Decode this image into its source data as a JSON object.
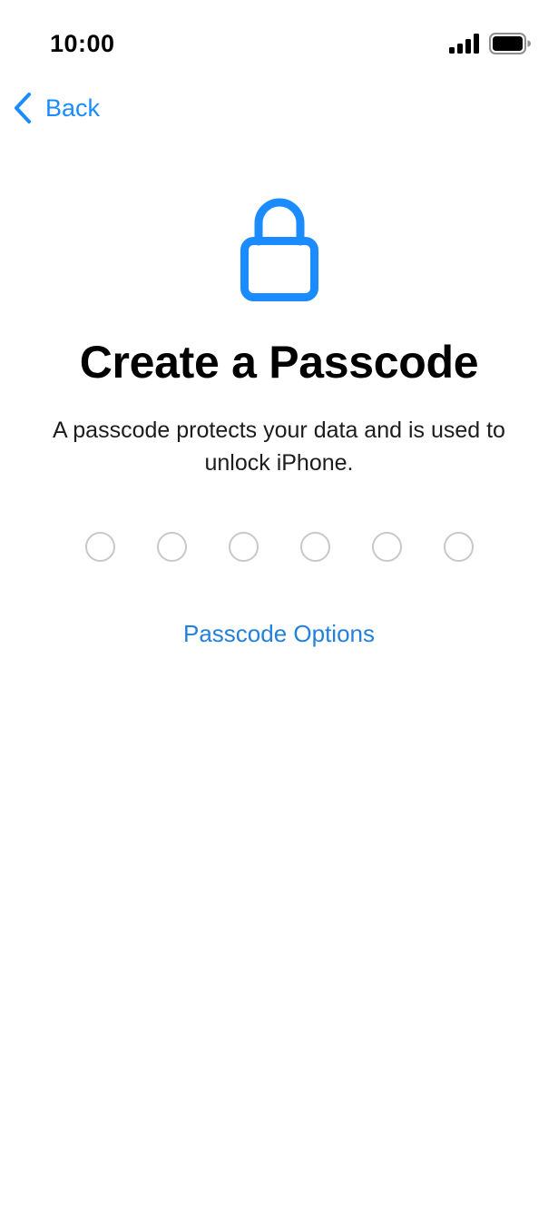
{
  "status_bar": {
    "time": "10:00",
    "icons": [
      "signal-icon",
      "battery-icon"
    ]
  },
  "nav": {
    "back_label": "Back",
    "back_icon": "chevron-left-icon"
  },
  "main": {
    "icon": "lock-icon",
    "title": "Create a Passcode",
    "description": "A passcode protects your data and is used to unlock iPhone.",
    "passcode_length": 6,
    "entered_digits": 0,
    "options_label": "Passcode Options"
  },
  "colors": {
    "accent": "#1a8cff",
    "link": "#2380db",
    "dot_outline": "#c8c8cc",
    "background": "#ffffff"
  }
}
